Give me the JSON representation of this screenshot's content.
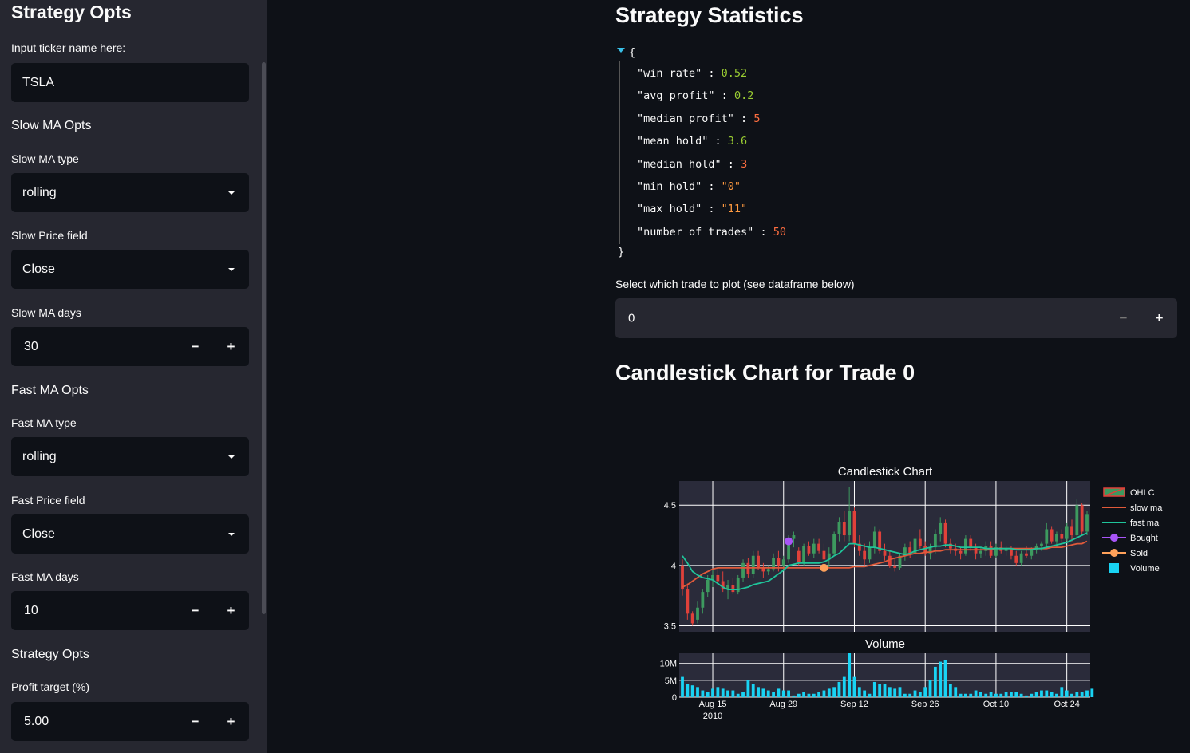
{
  "sidebar": {
    "title": "Strategy Opts",
    "ticker_label": "Input ticker name here:",
    "ticker_value": "TSLA",
    "slow_section": "Slow MA Opts",
    "slow_type_label": "Slow MA type",
    "slow_type_value": "rolling",
    "slow_price_label": "Slow Price field",
    "slow_price_value": "Close",
    "slow_days_label": "Slow MA days",
    "slow_days_value": "30",
    "fast_section": "Fast MA Opts",
    "fast_type_label": "Fast MA type",
    "fast_type_value": "rolling",
    "fast_price_label": "Fast Price field",
    "fast_price_value": "Close",
    "fast_days_label": "Fast MA days",
    "fast_days_value": "10",
    "strategy_section": "Strategy Opts",
    "profit_label": "Profit target (%)",
    "profit_value": "5.00",
    "minus": "−",
    "plus": "+"
  },
  "main": {
    "stats_title": "Strategy Statistics",
    "json_open": "{",
    "json_close": "}",
    "stats": [
      {
        "key": "\"win rate\"",
        "value": "0.52",
        "kind": "float"
      },
      {
        "key": "\"avg profit\"",
        "value": "0.2",
        "kind": "float"
      },
      {
        "key": "\"median profit\"",
        "value": "5",
        "kind": "int"
      },
      {
        "key": "\"mean hold\"",
        "value": "3.6",
        "kind": "float"
      },
      {
        "key": "\"median hold\"",
        "value": "3",
        "kind": "int"
      },
      {
        "key": "\"min hold\"",
        "value": "\"0\"",
        "kind": "str"
      },
      {
        "key": "\"max hold\"",
        "value": "\"11\"",
        "kind": "str"
      },
      {
        "key": "\"number of trades\"",
        "value": "50",
        "kind": "int"
      }
    ],
    "trade_label": "Select which trade to plot (see dataframe below)",
    "trade_value": "0",
    "chart_heading": "Candlestick Chart for Trade 0"
  },
  "chart_data": [
    {
      "type": "candlestick",
      "title": "Candlestick Chart",
      "y_ticks": [
        "3.5",
        "4",
        "4.5"
      ],
      "ylim": [
        3.45,
        4.7
      ],
      "x_start": "2010-08-09",
      "x_end": "2010-11-01",
      "legend": [
        "OHLC",
        "slow ma",
        "fast ma",
        "Bought",
        "Sold",
        "Volume"
      ],
      "legend_placement": "right",
      "colors": {
        "up": "#3d9a5f",
        "down": "#e0413a",
        "slow_ma": "#e05a3a",
        "fast_ma": "#1fc49a",
        "bought": "#a855f7",
        "sold": "#ffa15a",
        "volume": "#19d3f3",
        "bg": "#2a2b3a"
      },
      "ohlc": [
        [
          4.0,
          4.05,
          3.75,
          3.8
        ],
        [
          3.8,
          3.85,
          3.55,
          3.6
        ],
        [
          3.6,
          3.62,
          3.5,
          3.52
        ],
        [
          3.55,
          3.7,
          3.52,
          3.65
        ],
        [
          3.65,
          3.8,
          3.6,
          3.78
        ],
        [
          3.78,
          3.92,
          3.74,
          3.88
        ],
        [
          3.88,
          3.96,
          3.82,
          3.92
        ],
        [
          3.92,
          3.98,
          3.84,
          3.87
        ],
        [
          3.87,
          3.95,
          3.78,
          3.8
        ],
        [
          3.8,
          3.88,
          3.72,
          3.84
        ],
        [
          3.84,
          3.9,
          3.76,
          3.78
        ],
        [
          3.78,
          3.92,
          3.76,
          3.9
        ],
        [
          3.9,
          4.05,
          3.86,
          4.02
        ],
        [
          4.02,
          4.06,
          3.9,
          3.93
        ],
        [
          3.93,
          4.12,
          3.9,
          4.08
        ],
        [
          4.08,
          4.12,
          3.96,
          3.98
        ],
        [
          3.98,
          4.02,
          3.9,
          3.95
        ],
        [
          3.95,
          4.0,
          3.92,
          3.97
        ],
        [
          3.97,
          4.1,
          3.95,
          4.06
        ],
        [
          4.06,
          4.12,
          3.95,
          4.0
        ],
        [
          4.0,
          4.08,
          3.96,
          4.05
        ],
        [
          4.05,
          4.25,
          4.02,
          4.22
        ],
        [
          4.22,
          4.28,
          4.15,
          4.25
        ],
        [
          4.12,
          4.15,
          4.0,
          4.03
        ],
        [
          4.03,
          4.18,
          4.0,
          4.16
        ],
        [
          4.16,
          4.2,
          4.08,
          4.1
        ],
        [
          4.1,
          4.22,
          4.06,
          4.18
        ],
        [
          4.18,
          4.22,
          4.1,
          4.12
        ],
        [
          4.12,
          4.18,
          4.02,
          4.05
        ],
        [
          4.05,
          4.15,
          3.98,
          4.1
        ],
        [
          4.1,
          4.28,
          4.08,
          4.26
        ],
        [
          4.26,
          4.4,
          4.2,
          4.36
        ],
        [
          4.36,
          4.45,
          4.2,
          4.25
        ],
        [
          4.25,
          4.65,
          4.2,
          4.45
        ],
        [
          4.45,
          4.48,
          4.15,
          4.18
        ],
        [
          4.18,
          4.25,
          4.08,
          4.12
        ],
        [
          4.12,
          4.18,
          4.0,
          4.05
        ],
        [
          4.05,
          4.2,
          4.02,
          4.15
        ],
        [
          4.15,
          4.32,
          4.1,
          4.28
        ],
        [
          4.28,
          4.3,
          4.1,
          4.12
        ],
        [
          4.12,
          4.18,
          4.04,
          4.08
        ],
        [
          4.08,
          4.12,
          3.98,
          4.0
        ],
        [
          4.0,
          4.05,
          3.95,
          3.98
        ],
        [
          3.98,
          4.1,
          3.96,
          4.08
        ],
        [
          4.08,
          4.18,
          4.04,
          4.15
        ],
        [
          4.15,
          4.2,
          4.06,
          4.1
        ],
        [
          4.1,
          4.25,
          4.05,
          4.22
        ],
        [
          4.22,
          4.3,
          4.14,
          4.16
        ],
        [
          4.16,
          4.2,
          4.08,
          4.1
        ],
        [
          4.1,
          4.18,
          4.05,
          4.15
        ],
        [
          4.15,
          4.3,
          4.1,
          4.26
        ],
        [
          4.26,
          4.4,
          4.2,
          4.35
        ],
        [
          4.35,
          4.38,
          4.15,
          4.18
        ],
        [
          4.18,
          4.22,
          4.1,
          4.14
        ],
        [
          4.14,
          4.18,
          4.08,
          4.12
        ],
        [
          4.12,
          4.15,
          4.05,
          4.1
        ],
        [
          4.1,
          4.25,
          4.08,
          4.22
        ],
        [
          4.22,
          4.25,
          4.12,
          4.15
        ],
        [
          4.15,
          4.18,
          4.05,
          4.1
        ],
        [
          4.1,
          4.15,
          4.06,
          4.12
        ],
        [
          4.12,
          4.2,
          4.08,
          4.16
        ],
        [
          4.16,
          4.2,
          4.06,
          4.08
        ],
        [
          4.08,
          4.18,
          4.06,
          4.15
        ],
        [
          4.15,
          4.2,
          4.1,
          4.12
        ],
        [
          4.12,
          4.16,
          4.08,
          4.14
        ],
        [
          4.14,
          4.16,
          4.05,
          4.08
        ],
        [
          4.08,
          4.12,
          4.0,
          4.02
        ],
        [
          4.02,
          4.12,
          4.0,
          4.1
        ],
        [
          4.1,
          4.16,
          4.06,
          4.08
        ],
        [
          4.08,
          4.15,
          4.05,
          4.13
        ],
        [
          4.13,
          4.18,
          4.1,
          4.16
        ],
        [
          4.16,
          4.2,
          4.12,
          4.18
        ],
        [
          4.18,
          4.35,
          4.15,
          4.3
        ],
        [
          4.3,
          4.32,
          4.18,
          4.2
        ],
        [
          4.2,
          4.28,
          4.15,
          4.26
        ],
        [
          4.26,
          4.3,
          4.18,
          4.22
        ],
        [
          4.22,
          4.35,
          4.2,
          4.32
        ],
        [
          4.32,
          4.38,
          4.2,
          4.25
        ],
        [
          4.25,
          4.55,
          4.22,
          4.5
        ],
        [
          4.5,
          4.52,
          4.25,
          4.28
        ],
        [
          4.28,
          4.45,
          4.25,
          4.42
        ]
      ],
      "slow_ma": [
        3.82,
        3.84,
        3.87,
        3.9,
        3.93,
        3.95,
        3.97,
        3.98,
        3.98,
        3.98,
        3.98,
        3.98,
        3.98,
        3.98,
        3.98,
        3.98,
        3.98,
        3.98,
        3.98,
        3.98,
        3.98,
        3.98,
        3.98,
        3.98,
        3.98,
        3.98,
        3.98,
        3.98,
        3.98,
        3.98,
        3.98,
        3.98,
        3.98,
        3.98,
        3.99,
        3.99,
        3.99,
        4.0,
        4.01,
        4.02,
        4.03,
        4.05,
        4.06,
        4.07,
        4.08,
        4.09,
        4.1,
        4.1,
        4.11,
        4.11,
        4.12,
        4.12,
        4.13,
        4.13,
        4.13,
        4.13,
        4.13,
        4.13,
        4.13,
        4.13,
        4.13,
        4.13,
        4.14,
        4.14,
        4.14,
        4.14,
        4.14,
        4.14,
        4.14,
        4.14,
        4.14,
        4.14,
        4.14,
        4.15,
        4.15,
        4.15,
        4.16,
        4.17,
        4.18,
        4.18,
        4.2
      ],
      "fast_ma": [
        4.08,
        4.02,
        3.95,
        3.92,
        3.9,
        3.89,
        3.88,
        3.85,
        3.82,
        3.8,
        3.8,
        3.8,
        3.81,
        3.82,
        3.84,
        3.85,
        3.86,
        3.87,
        3.9,
        3.93,
        3.96,
        4.0,
        4.01,
        4.02,
        4.02,
        4.02,
        4.02,
        4.02,
        4.03,
        4.05,
        4.08,
        4.1,
        4.14,
        4.18,
        4.18,
        4.17,
        4.16,
        4.15,
        4.15,
        4.14,
        4.13,
        4.12,
        4.11,
        4.1,
        4.09,
        4.1,
        4.12,
        4.13,
        4.14,
        4.15,
        4.16,
        4.16,
        4.17,
        4.17,
        4.16,
        4.15,
        4.15,
        4.15,
        4.15,
        4.15,
        4.14,
        4.14,
        4.14,
        4.14,
        4.14,
        4.14,
        4.13,
        4.13,
        4.13,
        4.13,
        4.14,
        4.14,
        4.15,
        4.16,
        4.17,
        4.18,
        4.19,
        4.21,
        4.23,
        4.25,
        4.27
      ],
      "bought": [
        {
          "i": 21,
          "y": 4.2
        }
      ],
      "sold": [
        {
          "i": 28,
          "y": 3.98
        }
      ]
    },
    {
      "type": "bar",
      "title": "Volume",
      "y_ticks": [
        "0",
        "5M",
        "10M"
      ],
      "ylim": [
        0,
        13000000
      ],
      "x_tick_labels": [
        "Aug 15",
        "Aug 29",
        "Sep 12",
        "Sep 26",
        "Oct 10",
        "Oct 24"
      ],
      "x_year_label": "2010",
      "values": [
        6,
        4,
        3.5,
        3,
        2,
        1.5,
        2.5,
        3,
        2.5,
        2,
        2,
        1,
        1.5,
        5,
        4,
        3,
        2.5,
        2,
        1.5,
        2.5,
        2,
        2,
        0.5,
        1,
        1.5,
        1,
        1,
        1.5,
        2,
        2.5,
        3,
        4.5,
        6,
        13,
        6,
        3,
        2,
        1,
        4.5,
        4,
        4,
        3,
        2.5,
        3,
        1,
        1,
        2,
        1.5,
        3,
        5,
        9,
        10.5,
        11,
        4,
        3,
        1,
        1,
        1,
        2,
        1.5,
        1,
        1.5,
        1,
        1,
        1.5,
        1.5,
        1.5,
        1,
        0.5,
        1,
        1.5,
        2,
        2,
        1.5,
        1,
        3,
        2,
        1,
        1.5,
        1.5,
        2,
        2.5
      ]
    }
  ]
}
